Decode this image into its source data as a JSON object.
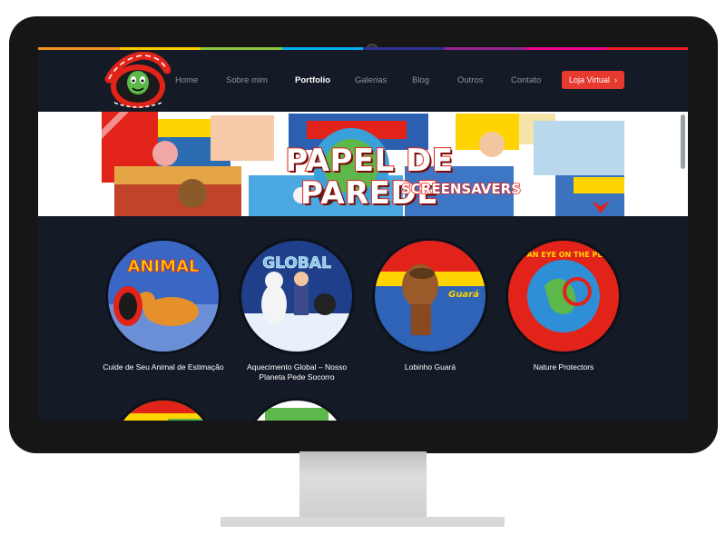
{
  "site": {
    "logo_alt": "Studio Arte",
    "accent_color": "#e63a30",
    "background_color": "#151b26",
    "top_colors": [
      "#f7941d",
      "#ffcc00",
      "#8dc63f",
      "#00aeef",
      "#2e3192",
      "#92278f",
      "#ec008c",
      "#ed1c24"
    ]
  },
  "nav": {
    "items": [
      {
        "label": "Home",
        "active": false
      },
      {
        "label": "Sobre mim",
        "active": false
      },
      {
        "label": "Portfolio",
        "active": true
      },
      {
        "label": "Galerias",
        "active": false
      },
      {
        "label": "Blog",
        "active": false
      },
      {
        "label": "Outros",
        "active": false
      },
      {
        "label": "Contato",
        "active": false
      }
    ],
    "store_button": "Loja Virtual",
    "store_icon": "chevron-right-icon"
  },
  "hero": {
    "title": "PAPEL DE PAREDE",
    "subtitle": "SCREENSAVERS"
  },
  "portfolio": {
    "items": [
      {
        "title": "Cuide de Seu Animal de Estimação",
        "thumb_text": "ANIMAL"
      },
      {
        "title": "Aquecimento Global – Nosso Planeta Pede Socorro",
        "thumb_text": "GLOBAL"
      },
      {
        "title": "Lobinho Guará",
        "thumb_text": "Guará"
      },
      {
        "title": "Nature Protectors",
        "thumb_text": "KEEP AN EYE ON THE PLANET"
      },
      {
        "title": "",
        "thumb_text": ""
      },
      {
        "title": "",
        "thumb_text": ""
      }
    ]
  }
}
